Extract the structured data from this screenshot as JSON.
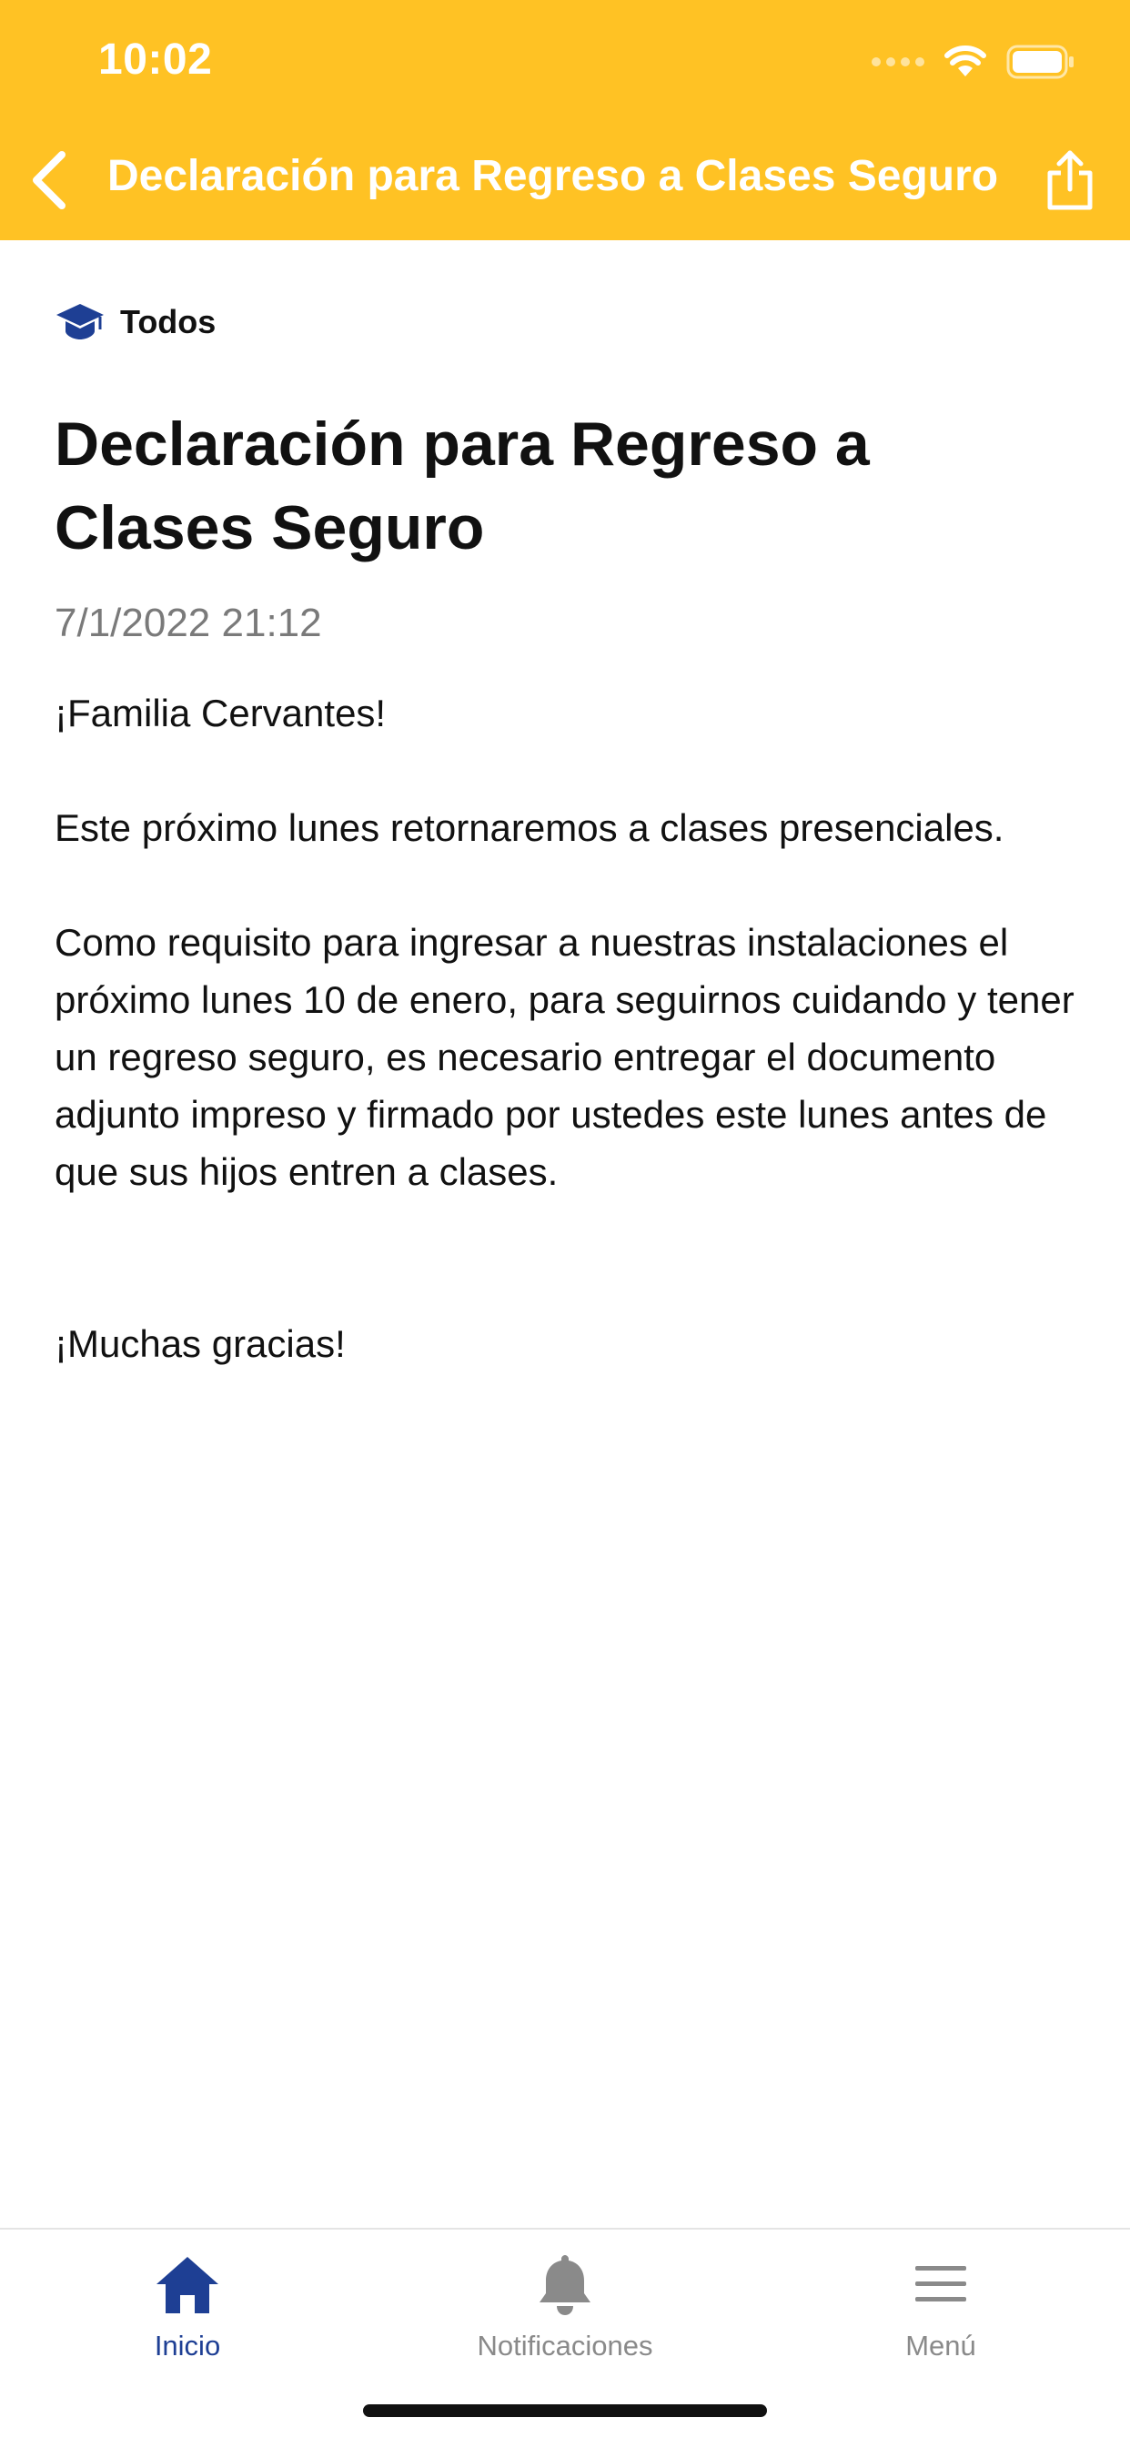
{
  "status_bar": {
    "time": "10:02"
  },
  "header": {
    "title": "Declaración para Regreso a Clases Seguro",
    "background_color": "#FFC224"
  },
  "post": {
    "category": "Todos",
    "title": "Declaración para Regreso a Clases Seguro",
    "date": "7/1/2022 21:12",
    "body": {
      "greeting": "¡Familia Cervantes!",
      "paragraph_1": "Este próximo lunes retornaremos a clases presenciales.",
      "paragraph_2": "Como requisito para ingresar a nuestras instalaciones el próximo lunes 10 de enero, para seguirnos cuidando y tener un regreso seguro, es necesario entregar el documento adjunto impreso y firmado por ustedes este lunes antes de que sus hijos entren a clases.",
      "closing": "¡Muchas gracias!"
    }
  },
  "tab_bar": {
    "accent_color": "#1E3F94",
    "tabs": [
      {
        "label": "Inicio",
        "icon": "home-icon",
        "active": true
      },
      {
        "label": "Notificaciones",
        "icon": "bell-icon",
        "active": false
      },
      {
        "label": "Menú",
        "icon": "hamburger-menu-icon",
        "active": false
      }
    ]
  }
}
